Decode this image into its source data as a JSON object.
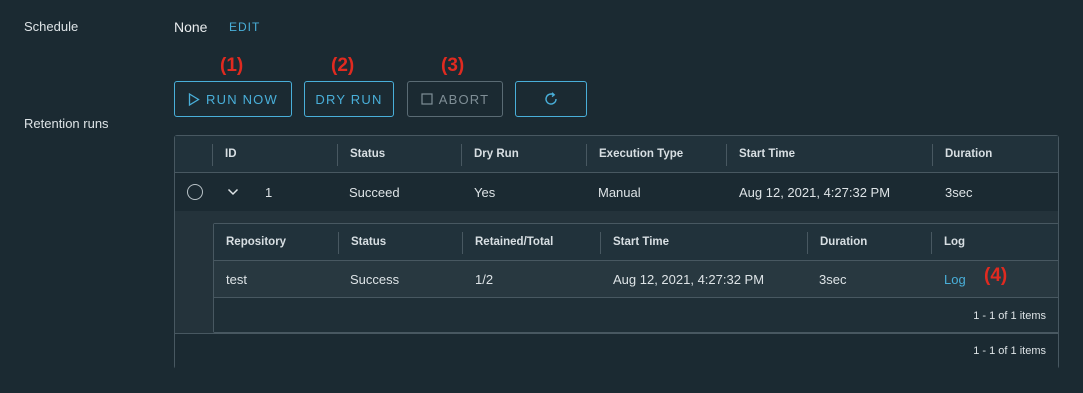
{
  "schedule": {
    "label": "Schedule",
    "value": "None",
    "edit_label": "EDIT"
  },
  "annotations": [
    "(1)",
    "(2)",
    "(3)",
    "(4)"
  ],
  "toolbar": {
    "run_now_label": "RUN NOW",
    "dry_run_label": "DRY RUN",
    "abort_label": "ABORT",
    "refresh_icon": "refresh-icon"
  },
  "retention": {
    "label": "Retention runs",
    "columns": [
      "ID",
      "Status",
      "Dry Run",
      "Execution Type",
      "Start Time",
      "Duration"
    ],
    "rows": [
      {
        "id": "1",
        "status": "Succeed",
        "dry_run": "Yes",
        "execution_type": "Manual",
        "start_time": "Aug 12, 2021, 4:27:32 PM",
        "duration": "3sec",
        "detail": {
          "columns": [
            "Repository",
            "Status",
            "Retained/Total",
            "Start Time",
            "Duration",
            "Log"
          ],
          "rows": [
            {
              "repository": "test",
              "status": "Success",
              "retained_total": "1/2",
              "start_time": "Aug 12, 2021, 4:27:32 PM",
              "duration": "3sec",
              "log": "Log"
            }
          ],
          "footer": "1 - 1 of 1 items"
        }
      }
    ],
    "footer": "1 - 1 of 1 items"
  },
  "colors": {
    "background": "#1b2a32",
    "accent": "#49afd9",
    "annotation": "#e02a20",
    "border": "#485861"
  }
}
